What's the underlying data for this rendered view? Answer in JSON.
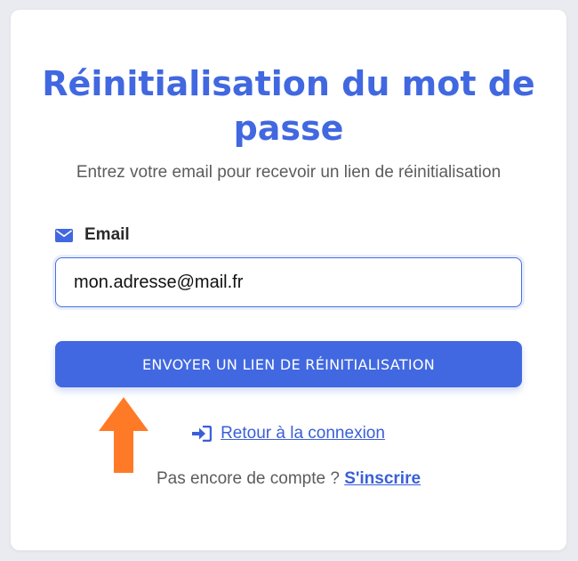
{
  "header": {
    "title": "Réinitialisation du mot de passe",
    "subtitle": "Entrez votre email pour recevoir un lien de réinitialisation"
  },
  "form": {
    "email_label": "Email",
    "email_icon": "envelope-icon",
    "email_value": "mon.adresse@mail.fr",
    "submit_label": "ENVOYER UN LIEN DE RÉINITIALISATION"
  },
  "links": {
    "back_icon": "sign-in-icon",
    "back_label": " Retour à la connexion",
    "signup_prompt": "Pas encore de compte ? ",
    "signup_label": "S'inscrire"
  },
  "annotation": {
    "icon": "up-arrow-icon",
    "color": "#ff7a26"
  },
  "colors": {
    "accent": "#4168e0",
    "background": "#e9ebf0",
    "card": "#ffffff"
  }
}
